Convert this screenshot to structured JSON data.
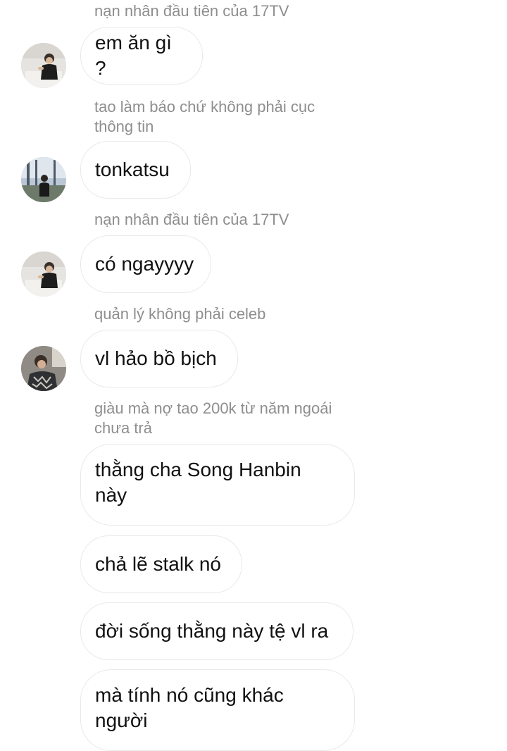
{
  "messages": [
    {
      "sender": "nạn nhân đầu tiên của 17TV",
      "text": "em ăn gì ?",
      "avatar": "man-sitting-photo"
    },
    {
      "sender": "tao làm báo chứ không phải cục thông tin",
      "text": "tonkatsu",
      "avatar": "person-by-window-photo"
    },
    {
      "sender": "nạn nhân đầu tiên của 17TV",
      "text": "có ngayyyy",
      "avatar": "man-sitting-photo"
    },
    {
      "sender": "quản lý không phải celeb",
      "text": "vl hảo bồ bịch",
      "avatar": "man-patterned-shirt-photo"
    },
    {
      "sender": "giàu mà nợ tao 200k từ năm ngoái chưa trả",
      "texts": [
        "thằng cha Song Hanbin này",
        "chả lẽ stalk nó",
        "đời sống thằng này tệ vl ra",
        "mà tính nó cũng khác người"
      ]
    }
  ]
}
